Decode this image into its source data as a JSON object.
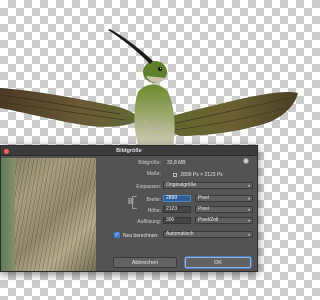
{
  "dialog": {
    "title": "Bildgröße",
    "image_size_label": "Bildgröße:",
    "image_size_value": "32,8 MB",
    "dimensions_label": "Maße:",
    "dimensions_width": "2899 Px",
    "dimensions_sep": "×",
    "dimensions_height": "2123 Px",
    "fit_label": "Einpassen:",
    "fit_value": "Originalgröße",
    "width_label": "Breite:",
    "width_value": "2899",
    "width_unit": "Pixel",
    "height_label": "Höhe:",
    "height_value": "2123",
    "height_unit": "Pixel",
    "resolution_label": "Auflösung:",
    "resolution_value": "300",
    "resolution_unit": "Pixel/Zoll",
    "resample_label": "Neu berechnen:",
    "resample_value": "Automatisch",
    "resample_checked": true,
    "cancel_label": "Abbrechen",
    "ok_label": "OK"
  },
  "icons": {
    "close": "close-dot-icon",
    "settings": "gear-icon",
    "link": "chain-link-icon",
    "checkbox": "checkmark-icon"
  },
  "colors": {
    "dialog_bg": "#535353",
    "titlebar_bg": "#3c3c3c",
    "accent": "#3c7fd6",
    "selection": "#2f5f97"
  }
}
